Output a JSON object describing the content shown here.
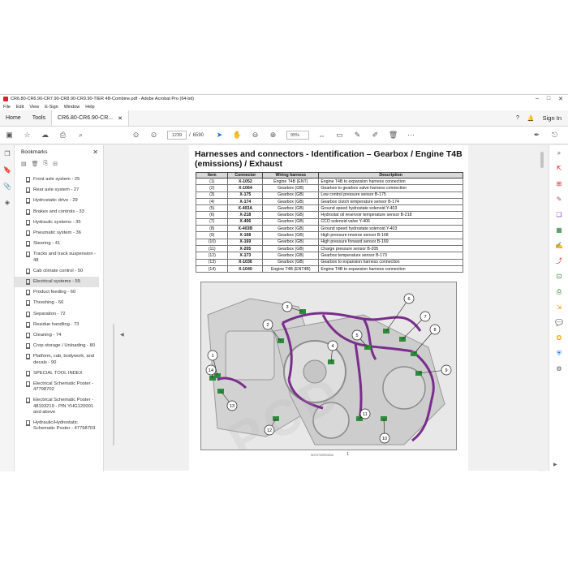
{
  "window": {
    "title": "CR6.80-CR6.90-CR7.90-CR8.90-CR9.90-TIER 4B-Combine.pdf - Adobe Acrobat Pro (64-bit)"
  },
  "menu": [
    "File",
    "Edit",
    "View",
    "E-Sign",
    "Window",
    "Help"
  ],
  "tabs": {
    "home": "Home",
    "tools": "Tools",
    "doc": "CR6.80-CR6.90-CR...",
    "sign_in": "Sign In"
  },
  "toolbar": {
    "page_current": "1239",
    "page_sep": "/",
    "page_total": "6590",
    "zoom": "95%"
  },
  "bookmarks": {
    "title": "Bookmarks",
    "items": [
      {
        "label": "Front axle system - 25",
        "selected": false
      },
      {
        "label": "Rear axle system - 27",
        "selected": false
      },
      {
        "label": "Hydrostatic drive - 29",
        "selected": false
      },
      {
        "label": "Brakes and controls - 33",
        "selected": false
      },
      {
        "label": "Hydraulic systems - 35",
        "selected": false
      },
      {
        "label": "Pneumatic system - 36",
        "selected": false
      },
      {
        "label": "Steering - 41",
        "selected": false
      },
      {
        "label": "Tracks and track suspension - 48",
        "selected": false
      },
      {
        "label": "Cab climate control - 50",
        "selected": false
      },
      {
        "label": "Electrical systems - 55",
        "selected": true
      },
      {
        "label": "Product feeding - 60",
        "selected": false
      },
      {
        "label": "Threshing - 66",
        "selected": false
      },
      {
        "label": "Separation - 72",
        "selected": false
      },
      {
        "label": "Residue handling - 73",
        "selected": false
      },
      {
        "label": "Cleaning - 74",
        "selected": false
      },
      {
        "label": "Crop storage / Unloading - 80",
        "selected": false
      },
      {
        "label": "Platform, cab, bodywork, and decals - 90",
        "selected": false
      },
      {
        "label": "SPECIAL TOOL INDEX",
        "selected": false
      },
      {
        "label": "Electrical Schematic Poster - 47798702",
        "selected": false
      },
      {
        "label": "Electrical Schematic Poster - 48193219 - PIN YHG120001 and above",
        "selected": false
      },
      {
        "label": "Hydraulic/Hydrostatic Schematic Poster - 47798703",
        "selected": false
      }
    ]
  },
  "document": {
    "title": "Harnesses and connectors - Identification – Gearbox / Engine T4B (emissions) / Exhaust",
    "table": {
      "headers": [
        "Item",
        "Connector",
        "Wiring harness",
        "Description"
      ],
      "rows": [
        [
          "(1)",
          "X-1052",
          "Engine T4B (ENT)",
          "Engine T4B to expansion harness connection"
        ],
        [
          "(2)",
          "X-1064",
          "Gearbox (GB)",
          "Gearbox to gearbox valve harness connection"
        ],
        [
          "(3)",
          "X-175",
          "Gearbox (GB)",
          "Low control pressure sensor B-175"
        ],
        [
          "(4)",
          "X-174",
          "Gearbox (GB)",
          "Gearbox clutch temperature sensor B-174"
        ],
        [
          "(5)",
          "X-403A",
          "Gearbox (GB)",
          "Ground speed hydrostate solenoid Y-403"
        ],
        [
          "(6)",
          "X-218",
          "Gearbox (GB)",
          "Hydrostat oil reservoir temperature sensor B-218"
        ],
        [
          "(7)",
          "X-406",
          "Gearbox (GB)",
          "CCO solenoid valve Y-406"
        ],
        [
          "(8)",
          "X-403B",
          "Gearbox (GB)",
          "Ground speed hydrostate solenoid Y-403"
        ],
        [
          "(9)",
          "X-168",
          "Gearbox (GB)",
          "High pressure reverse sensor B-168"
        ],
        [
          "(10)",
          "X-169",
          "Gearbox (GB)",
          "High pressure forward sensor B-169"
        ],
        [
          "(11)",
          "X-205",
          "Gearbox (GB)",
          "Charge pressure sensor B-205"
        ],
        [
          "(12)",
          "X-173",
          "Gearbox (GB)",
          "Gearbox temperature sensor B-173"
        ],
        [
          "(13)",
          "X-1036",
          "Gearbox (GB)",
          "Gearbox to expansion harness connection"
        ],
        [
          "(14)",
          "X-1040",
          "Engine T4B (ENT4B)",
          "Engine T4B to expansion harness connection"
        ]
      ]
    },
    "callouts": [
      "1",
      "2",
      "3",
      "4",
      "5",
      "6",
      "7",
      "8",
      "9",
      "10",
      "11",
      "12",
      "13",
      "14"
    ],
    "figure_ref": "NH19T00R002BA",
    "page_number": "1",
    "watermark": "PCD"
  },
  "colors": {
    "harness": "#7a2d8c",
    "connector": "#2e8b3a",
    "accent": "#d8232a"
  }
}
